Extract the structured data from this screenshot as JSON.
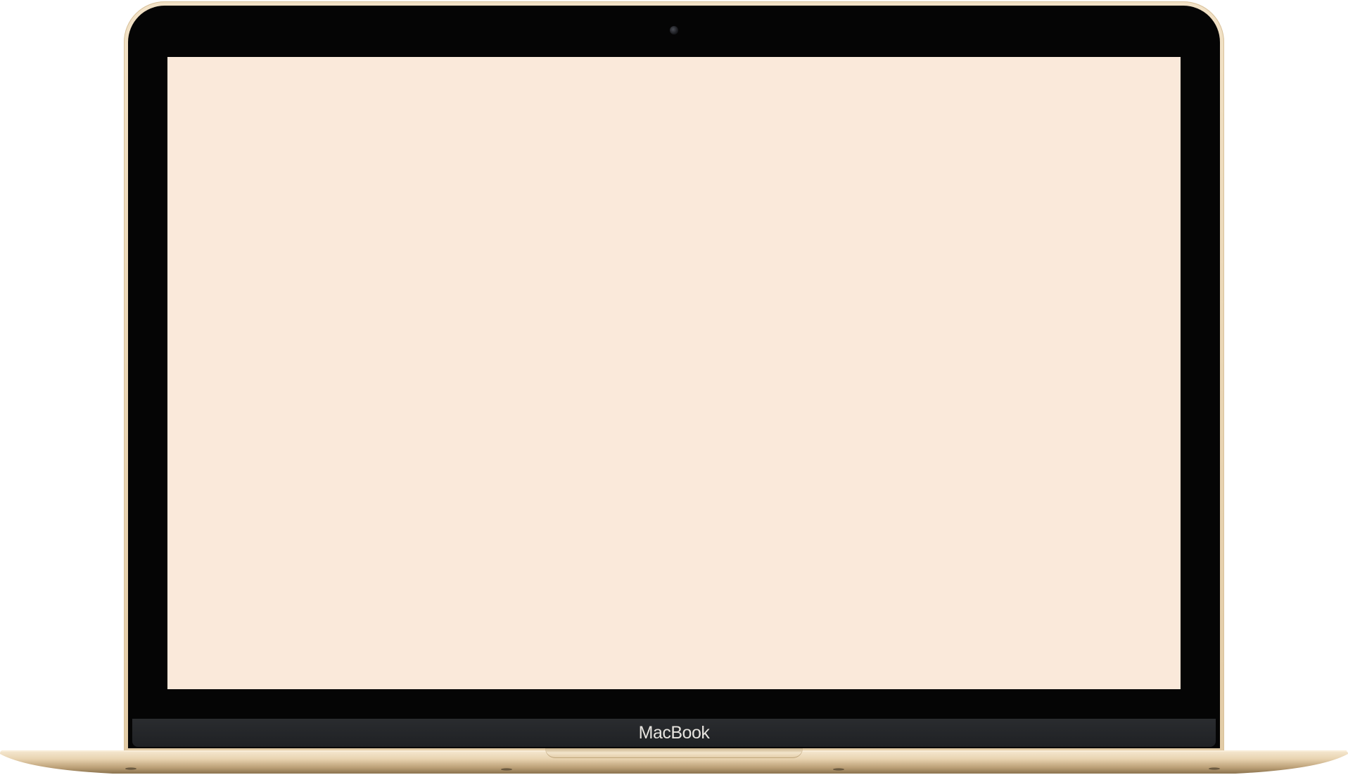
{
  "device": {
    "brand_label": "MacBook",
    "colors": {
      "shell": "#e9d5b4",
      "bezel": "#050505",
      "chin": "#1f2124",
      "screen": "#fae9da",
      "brand_text": "#e6e3de"
    }
  }
}
